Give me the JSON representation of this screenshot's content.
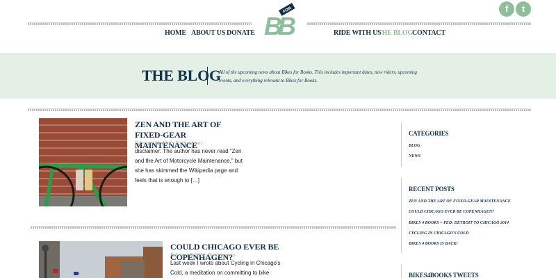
{
  "nav": {
    "left": [
      "HOME",
      "ABOUT US",
      "DONATE"
    ],
    "right": [
      "RIDE WITH US",
      "THE BLOG",
      "CONTACT"
    ]
  },
  "logo": {
    "letters": "BB",
    "ribbon": "FOR"
  },
  "social": {
    "facebook": "f",
    "twitter": "t"
  },
  "banner": {
    "title": "THE BLOG",
    "description": "All of the upcoming news about Bikes for Books. This includes important dates, new riders, upcoming events, and everything relevant to Bikes for Books."
  },
  "posts": [
    {
      "title": "ZEN AND THE ART OF FIXED-GEAR MAINTENANCE",
      "meta": "February 10, 2014 · No Comments",
      "excerpt": "disclaimer: The author has never read \"Zen and the Art of Motorcycle Maintenance,\" but she has skimmed the Wikipedia page and feels that is enough to […]"
    },
    {
      "title": "COULD CHICAGO EVER BE COPENHAGEN?",
      "meta": "February 7, 2014 · No Comments",
      "excerpt": "Last week I wrote about Cycling in Chicago's Cold, a meditation on committing to bike"
    }
  ],
  "sidebar": {
    "categories_heading": "CATEGORIES",
    "categories": [
      "BLOG",
      "NEWS"
    ],
    "recent_heading": "RECENT POSTS",
    "recent": [
      "ZEN AND THE ART OF FIXED-GEAR MAINTENANCE",
      "COULD CHICAGO EVER BE COPENHAGEN?",
      "BIKES 4 BOOKS + PED: DETROIT TO CHICAGO 2014",
      "CYCLING IN CHICAGO'S COLD",
      "BIKES 4 BOOKS IS BACK!"
    ],
    "tweets_heading": "BIKES4BOOKS TWEETS"
  },
  "colors": {
    "navy": "#13324a",
    "mint": "#8fbf9a",
    "banner": "#e4f0e5"
  }
}
